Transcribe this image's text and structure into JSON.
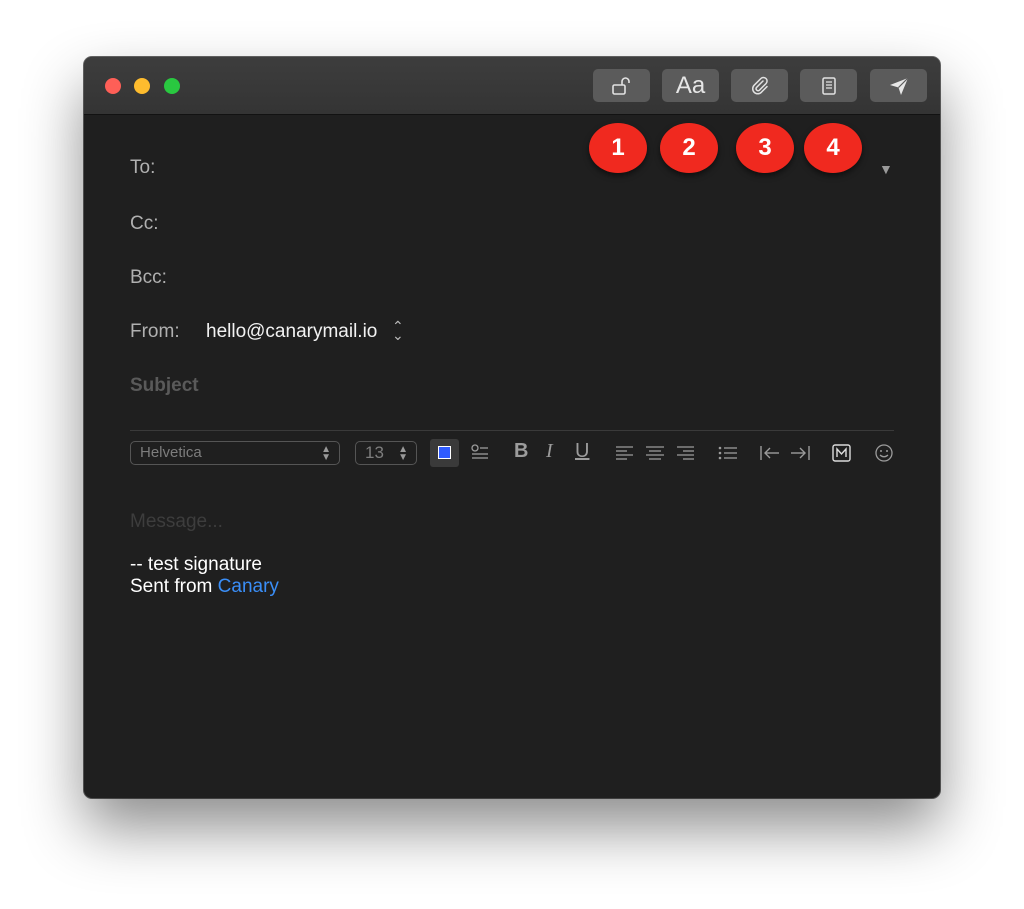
{
  "window": {
    "toolbar": {
      "encrypt_icon": "unlock-icon",
      "format_label": "Aa",
      "attach_icon": "paperclip-icon",
      "template_icon": "document-icon",
      "send_icon": "send-icon"
    },
    "badges": [
      "1",
      "2",
      "3",
      "4"
    ],
    "fields": {
      "to_label": "To:",
      "cc_label": "Cc:",
      "bcc_label": "Bcc:",
      "from_label": "From:",
      "from_value": "hello@canarymail.io",
      "subject_placeholder": "Subject"
    },
    "format_bar": {
      "font": "Helvetica",
      "size": "13",
      "color": "#2f5bff"
    },
    "message": {
      "placeholder": "Message...",
      "signature_line1": "-- test signature",
      "signature_line2_prefix": "Sent from ",
      "signature_link": "Canary"
    }
  },
  "colors": {
    "window_bg": "#1f1f1f",
    "titlebar": "#3a3a3a",
    "badge": "#f0291f",
    "link": "#3a8ef7"
  }
}
